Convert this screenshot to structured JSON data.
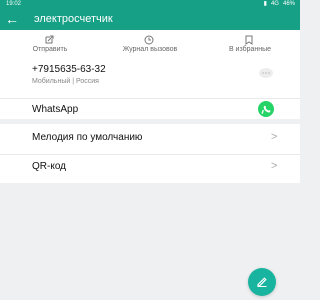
{
  "status": {
    "time": "19:02",
    "network": "4G",
    "battery": "46%"
  },
  "header": {
    "title": "электросчетчик"
  },
  "actions": [
    {
      "label": "Отправить",
      "icon": "share-icon"
    },
    {
      "label": "Журнал вызовов",
      "icon": "clock-icon"
    },
    {
      "label": "В избранные",
      "icon": "bookmark-icon"
    }
  ],
  "contact": {
    "phone": "+7915635-63-32",
    "meta": "Мобильный | Россия"
  },
  "whatsapp": {
    "label": "WhatsApp"
  },
  "menu": [
    {
      "label": "Мелодия по умолчанию"
    },
    {
      "label": "QR-код"
    }
  ],
  "fab": {
    "icon": "edit-icon"
  }
}
